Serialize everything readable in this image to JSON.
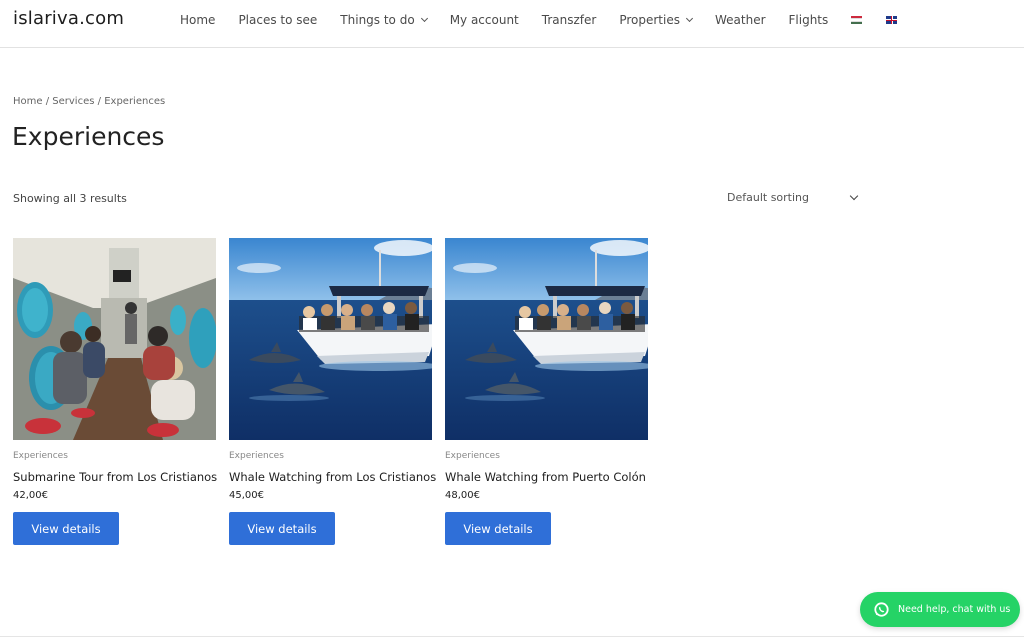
{
  "site": {
    "logo": "islariva.com"
  },
  "nav": {
    "items": [
      {
        "label": "Home",
        "dropdown": false
      },
      {
        "label": "Places to see",
        "dropdown": false
      },
      {
        "label": "Things to do",
        "dropdown": true
      },
      {
        "label": "My account",
        "dropdown": false
      },
      {
        "label": "Transzfer",
        "dropdown": false
      },
      {
        "label": "Properties",
        "dropdown": true
      },
      {
        "label": "Weather",
        "dropdown": false
      },
      {
        "label": "Flights",
        "dropdown": false
      }
    ],
    "flags": [
      "hungarian-flag-icon",
      "english-flag-icon"
    ]
  },
  "breadcrumb": {
    "home": "Home",
    "services": "Services",
    "current": "Experiences",
    "separator": "/"
  },
  "page": {
    "title": "Experiences",
    "result_count": "Showing all 3 results"
  },
  "sorting": {
    "selected": "Default sorting"
  },
  "products": [
    {
      "category": "Experiences",
      "name": "Submarine Tour from Los Cristianos",
      "price": "42,00€",
      "button": "View details",
      "image": "submarine-interior"
    },
    {
      "category": "Experiences",
      "name": "Whale Watching from Los Cristianos",
      "price": "45,00€",
      "button": "View details",
      "image": "boat-dolphins"
    },
    {
      "category": "Experiences",
      "name": "Whale Watching from Puerto Colón",
      "price": "48,00€",
      "button": "View details",
      "image": "boat-dolphins"
    }
  ],
  "chat": {
    "label": "Need help, chat with us",
    "icon": "whatsapp-icon"
  },
  "colors": {
    "button": "#2f6fd8",
    "chat": "#25d366",
    "text": "#222222"
  }
}
